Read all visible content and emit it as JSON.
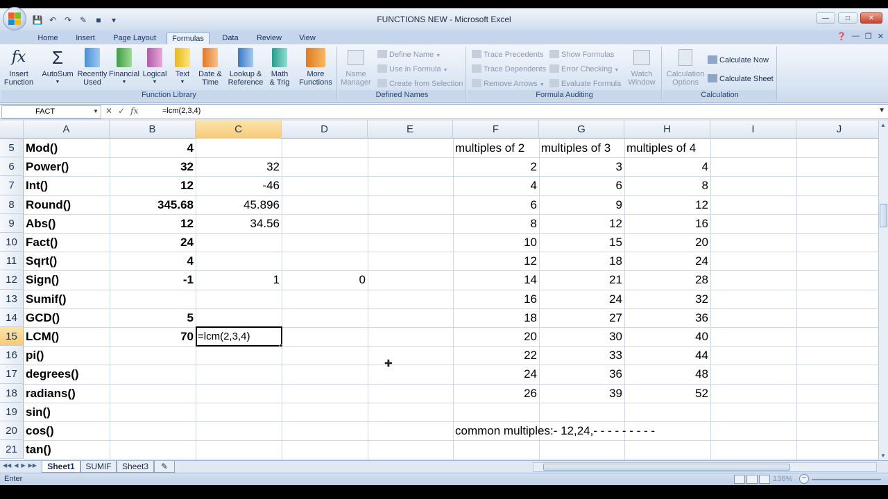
{
  "window": {
    "title": "FUNCTIONS NEW - Microsoft Excel"
  },
  "ribbon_tabs": [
    "Home",
    "Insert",
    "Page Layout",
    "Formulas",
    "Data",
    "Review",
    "View"
  ],
  "active_tab": "Formulas",
  "ribbon": {
    "function_library": {
      "label": "Function Library",
      "insert_function": "Insert\nFunction",
      "autosum": "AutoSum",
      "recently_used": "Recently\nUsed",
      "financial": "Financial",
      "logical": "Logical",
      "text": "Text",
      "date_time": "Date &\nTime",
      "lookup_reference": "Lookup &\nReference",
      "math_trig": "Math\n& Trig",
      "more_functions": "More\nFunctions"
    },
    "defined_names": {
      "label": "Defined Names",
      "name_manager": "Name\nManager",
      "define_name": "Define Name",
      "use_in_formula": "Use in Formula",
      "create_from_selection": "Create from Selection"
    },
    "formula_auditing": {
      "label": "Formula Auditing",
      "trace_precedents": "Trace Precedents",
      "trace_dependents": "Trace Dependents",
      "remove_arrows": "Remove Arrows",
      "show_formulas": "Show Formulas",
      "error_checking": "Error Checking",
      "evaluate_formula": "Evaluate Formula",
      "watch_window": "Watch\nWindow"
    },
    "calculation": {
      "label": "Calculation",
      "calculation_options": "Calculation\nOptions",
      "calculate_now": "Calculate Now",
      "calculate_sheet": "Calculate Sheet"
    }
  },
  "formula_bar": {
    "name_box": "FACT",
    "formula": "=lcm(2,3,4)"
  },
  "columns": [
    "A",
    "B",
    "C",
    "D",
    "E",
    "F",
    "G",
    "H",
    "I",
    "J"
  ],
  "selected_column": "C",
  "selected_row": "15",
  "rows": [
    {
      "num": "5",
      "A": "Mod()",
      "B": "4",
      "C": "",
      "D": "",
      "F": "multiples of 2",
      "G": "multiples of 3",
      "H": "multiples of 4"
    },
    {
      "num": "6",
      "A": "Power()",
      "B": "32",
      "C": "32",
      "D": "",
      "F": "2",
      "G": "3",
      "H": "4"
    },
    {
      "num": "7",
      "A": "Int()",
      "B": "12",
      "C": "-46",
      "D": "",
      "F": "4",
      "G": "6",
      "H": "8"
    },
    {
      "num": "8",
      "A": "Round()",
      "B": "345.68",
      "C": "45.896",
      "D": "",
      "F": "6",
      "G": "9",
      "H": "12"
    },
    {
      "num": "9",
      "A": "Abs()",
      "B": "12",
      "C": "34.56",
      "D": "",
      "F": "8",
      "G": "12",
      "H": "16"
    },
    {
      "num": "10",
      "A": "Fact()",
      "B": "24",
      "C": "",
      "D": "",
      "F": "10",
      "G": "15",
      "H": "20"
    },
    {
      "num": "11",
      "A": "Sqrt()",
      "B": "4",
      "C": "",
      "D": "",
      "F": "12",
      "G": "18",
      "H": "24"
    },
    {
      "num": "12",
      "A": "Sign()",
      "B": "-1",
      "C": "1",
      "D": "0",
      "F": "14",
      "G": "21",
      "H": "28"
    },
    {
      "num": "13",
      "A": "Sumif()",
      "B": "",
      "C": "",
      "D": "",
      "F": "16",
      "G": "24",
      "H": "32"
    },
    {
      "num": "14",
      "A": "GCD()",
      "B": "5",
      "C": "",
      "D": "",
      "F": "18",
      "G": "27",
      "H": "36"
    },
    {
      "num": "15",
      "A": "LCM()",
      "B": "70",
      "C": "=lcm(2,3,4)",
      "D": "",
      "F": "20",
      "G": "30",
      "H": "40"
    },
    {
      "num": "16",
      "A": "pi()",
      "B": "",
      "C": "",
      "D": "",
      "F": "22",
      "G": "33",
      "H": "44"
    },
    {
      "num": "17",
      "A": "degrees()",
      "B": "",
      "C": "",
      "D": "",
      "F": "24",
      "G": "36",
      "H": "48"
    },
    {
      "num": "18",
      "A": "radians()",
      "B": "",
      "C": "",
      "D": "",
      "F": "26",
      "G": "39",
      "H": "52"
    },
    {
      "num": "19",
      "A": "sin()",
      "B": "",
      "C": "",
      "D": "",
      "F": "",
      "G": "",
      "H": ""
    },
    {
      "num": "20",
      "A": "cos()",
      "B": "",
      "C": "",
      "D": "",
      "F": "common multiples:-  12,24,- - - - - - - - -",
      "G": "",
      "H": ""
    },
    {
      "num": "21",
      "A": "tan()",
      "B": "",
      "C": "",
      "D": "",
      "F": "",
      "G": "",
      "H": ""
    }
  ],
  "sheet_tabs": [
    "Sheet1",
    "SUMIF",
    "Sheet3"
  ],
  "active_sheet": "Sheet1",
  "status": {
    "mode": "Enter",
    "zoom": "136%"
  },
  "colors": {
    "selected_header": "#f7c97a",
    "ribbon_bg": "#dbe5f1",
    "grid_line": "#d0d7e5"
  }
}
